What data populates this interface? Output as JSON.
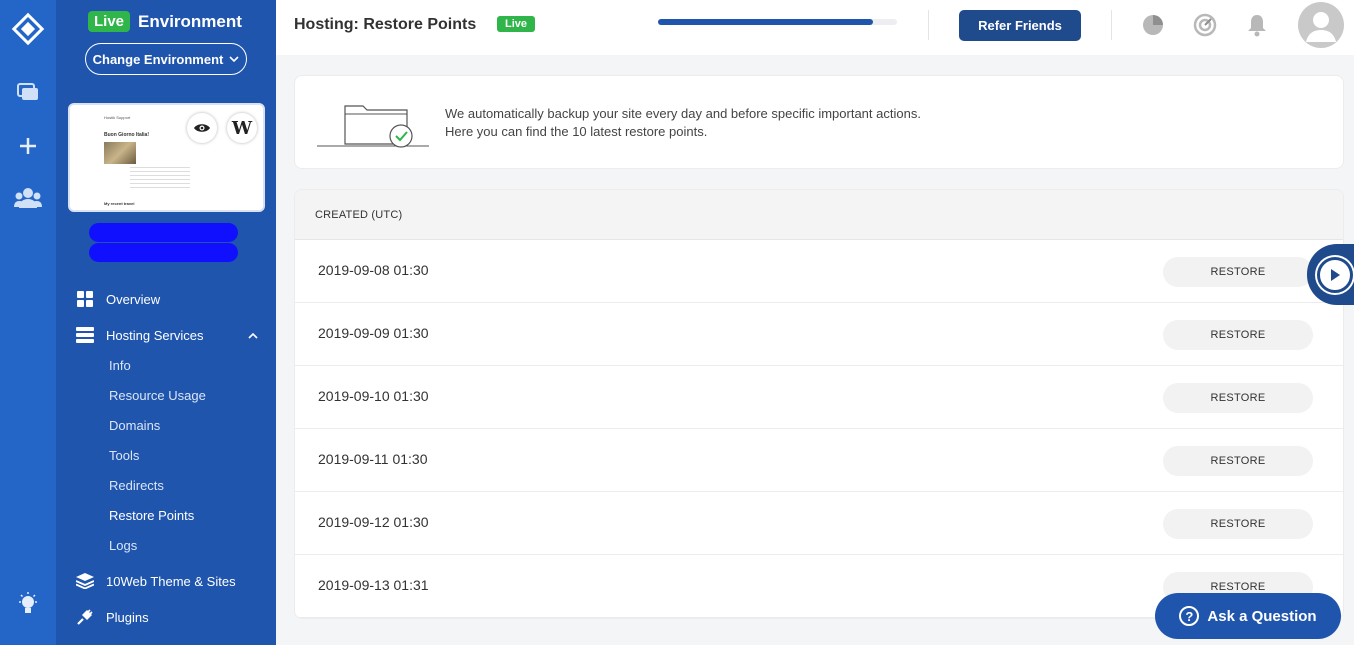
{
  "colors": {
    "rail": "#2466c7",
    "sidebar": "#1f55ad",
    "live_green": "#2fb54a",
    "primary_dark": "#1f4a8c"
  },
  "sidebar": {
    "live_badge": "Live",
    "environment_label": "Environment",
    "change_environment": "Change Environment",
    "preview": {
      "site_header": "Hostik Support",
      "post_title": "Buon Giorno Italia!",
      "footer_title": "My recent travel",
      "edit_icon": "wordpress-icon",
      "view_icon": "eye-icon"
    },
    "nav": [
      {
        "label": "Overview",
        "icon": "grid-icon"
      },
      {
        "label": "Hosting Services",
        "icon": "server-icon"
      },
      {
        "label": "10Web Theme & Sites",
        "icon": "layers-icon"
      },
      {
        "label": "Plugins",
        "icon": "plug-icon"
      }
    ],
    "hosting_sub": [
      "Info",
      "Resource Usage",
      "Domains",
      "Tools",
      "Redirects",
      "Restore Points",
      "Logs"
    ],
    "active_sub": "Restore Points"
  },
  "header": {
    "title": "Hosting: Restore Points",
    "live_badge": "Live",
    "progress": 0.9,
    "refer_button": "Refer Friends",
    "icons": [
      "pie-chart-icon",
      "speed-icon",
      "bell-icon",
      "avatar-icon"
    ]
  },
  "info": {
    "line1": "We automatically backup your site every day and before specific important actions.",
    "line2": "Here you can find the 10 latest restore points."
  },
  "table": {
    "column_header": "CREATED (UTC)",
    "restore_label": "RESTORE",
    "rows": [
      {
        "created": "2019-09-08 01:30"
      },
      {
        "created": "2019-09-09 01:30"
      },
      {
        "created": "2019-09-10 01:30"
      },
      {
        "created": "2019-09-11 01:30"
      },
      {
        "created": "2019-09-12 01:30"
      },
      {
        "created": "2019-09-13 01:31"
      }
    ]
  },
  "ask_button": "Ask a Question"
}
